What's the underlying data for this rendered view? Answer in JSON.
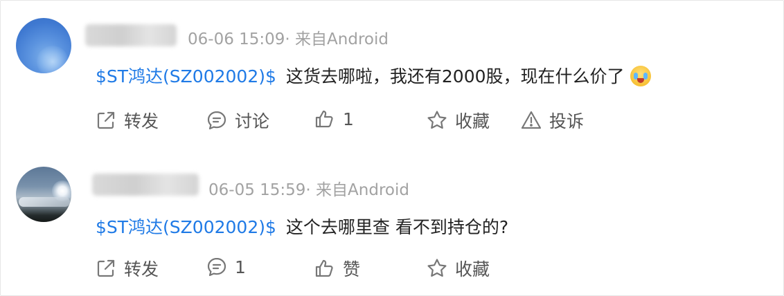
{
  "posts": [
    {
      "meta": "06-06 15:09· 来自Android",
      "stock": "$ST鸿达(SZ002002)$",
      "text": "这货去哪啦，我还有2000股，现在什么价了",
      "emoji_icon": "crying-laughing-emoji",
      "actions": {
        "repost": "转发",
        "comment": "讨论",
        "like": "1",
        "favorite": "收藏",
        "report": "投诉"
      }
    },
    {
      "meta": "06-05 15:59· 来自Android",
      "stock": "$ST鸿达(SZ002002)$",
      "text": "这个去哪里查 看不到持仓的?",
      "actions": {
        "repost": "转发",
        "comment": "1",
        "like": "赞",
        "favorite": "收藏"
      }
    }
  ],
  "colors": {
    "link": "#1f7ae6",
    "meta": "#a2a2a2",
    "text": "#222222",
    "action": "#555555",
    "icon": "#777777"
  }
}
